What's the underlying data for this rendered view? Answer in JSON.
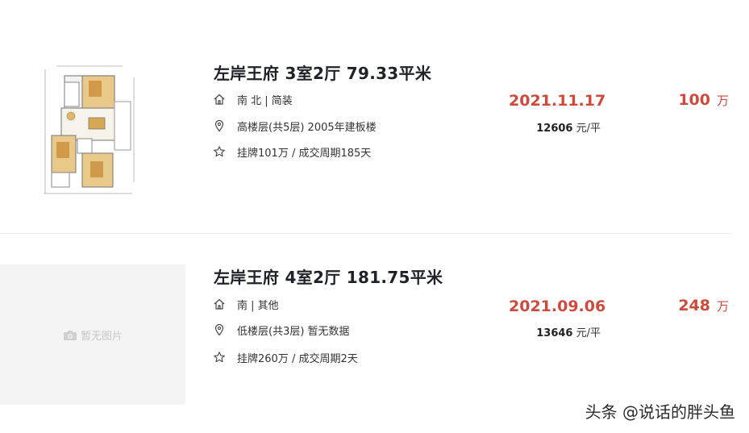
{
  "listings": [
    {
      "title": "左岸王府 3室2厅 79.33平米",
      "orientation": "南 北 | 简装",
      "floor": "高楼层(共5层) 2005年建板楼",
      "listing": "挂牌101万 / 成交周期185天",
      "date": "2021.11.17",
      "unit_price": "12606",
      "unit_price_suffix": "元/平",
      "total": "100",
      "total_unit": "万"
    },
    {
      "title": "左岸王府 4室2厅 181.75平米",
      "orientation": "南 | 其他",
      "floor": "低楼层(共3层) 暂无数据",
      "listing": "挂牌260万 / 成交周期2天",
      "date": "2021.09.06",
      "unit_price": "13646",
      "unit_price_suffix": "元/平",
      "total": "248",
      "total_unit": "万",
      "no_image_text": "暂无图片"
    }
  ],
  "watermark": "头条 @说话的胖头鱼",
  "colors": {
    "accent_red": "#cf4a3d",
    "title": "#1f2326",
    "placeholder_bg": "#f4f4f4"
  },
  "icons": [
    "house-icon",
    "location-pin-icon",
    "star-icon",
    "camera-icon"
  ]
}
